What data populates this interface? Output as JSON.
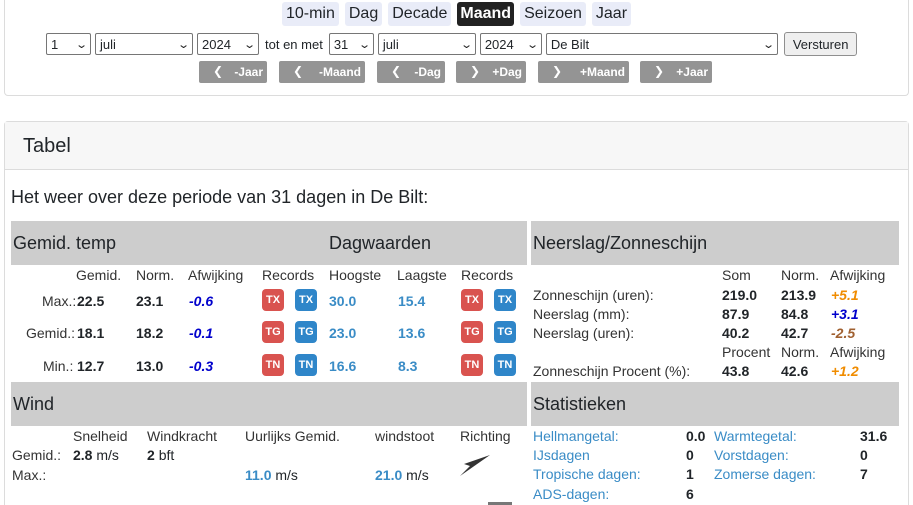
{
  "periods": [
    "10-min",
    "Dag",
    "Decade",
    "Maand",
    "Seizoen",
    "Jaar"
  ],
  "active_period": "Maand",
  "form": {
    "from_day": "1",
    "from_month": "juli",
    "from_year": "2024",
    "separator": "tot en met",
    "to_day": "31",
    "to_month": "juli",
    "to_year": "2024",
    "station": "De Bilt",
    "submit": "Versturen"
  },
  "nav": [
    "-Jaar",
    "-Maand",
    "-Dag",
    "+Dag",
    "+Maand",
    "+Jaar"
  ],
  "card_title": "Tabel",
  "intro": "Het weer over deze periode van 31 dagen in De Bilt:",
  "temp": {
    "title": "Gemid. temp",
    "daily_title": "Dagwaarden",
    "headers": {
      "gemid": "Gemid.",
      "norm": "Norm.",
      "afw": "Afwijking",
      "records": "Records",
      "hoogste": "Hoogste",
      "laagste": "Laagste",
      "records2": "Records"
    },
    "rows": [
      {
        "label": "Max.:",
        "value": "22.5",
        "norm": "23.1",
        "afw": "-0.6",
        "b1": "TX",
        "b2": "TX",
        "hoogste": "30.0",
        "laagste": "15.4",
        "b3": "TX",
        "b4": "TX"
      },
      {
        "label": "Gemid.:",
        "value": "18.1",
        "norm": "18.2",
        "afw": "-0.1",
        "b1": "TG",
        "b2": "TG",
        "hoogste": "23.0",
        "laagste": "13.6",
        "b3": "TG",
        "b4": "TG"
      },
      {
        "label": "Min.:",
        "value": "12.7",
        "norm": "13.0",
        "afw": "-0.3",
        "b1": "TN",
        "b2": "TN",
        "hoogste": "16.6",
        "laagste": "8.3",
        "b3": "TN",
        "b4": "TN"
      }
    ]
  },
  "neerslag": {
    "title": "Neerslag/Zonneschijn",
    "headers": {
      "som": "Som",
      "norm": "Norm.",
      "afw": "Afwijking",
      "procent": "Procent"
    },
    "rows": [
      {
        "label": "Zonneschijn (uren):",
        "value": "219.0",
        "norm": "213.9",
        "afw": "+5.1"
      },
      {
        "label": "Neerslag (mm):",
        "value": "87.9",
        "norm": "84.8",
        "afw": "+3.1"
      },
      {
        "label": "Neerslag (uren):",
        "value": "40.2",
        "norm": "42.7",
        "afw": "-2.5"
      },
      {
        "label": "Zonneschijn Procent (%):",
        "value": "43.8",
        "norm": "42.6",
        "afw": "+1.2"
      }
    ]
  },
  "wind": {
    "title": "Wind",
    "headers": {
      "snelheid": "Snelheid",
      "kracht": "Windkracht",
      "uurlijks": "Uurlijks Gemid.",
      "stoot": "windstoot",
      "richting": "Richting"
    },
    "gemid_label": "Gemid.:",
    "max_label": "Max.:",
    "gemid_speed": "2.8",
    "unit": "m/s",
    "gemid_bft": "2",
    "bft_unit": "bft",
    "max_uurlijks": "11.0",
    "max_stoot": "21.0"
  },
  "stats": {
    "title": "Statistieken",
    "left": [
      {
        "label": "Hellmangetal:",
        "value": "0.0"
      },
      {
        "label": "IJsdagen",
        "value": "0"
      },
      {
        "label": "Tropische dagen:",
        "value": "1"
      },
      {
        "label": "ADS-dagen:",
        "value": "6"
      }
    ],
    "right": [
      {
        "label": "Warmtegetal:",
        "value": "31.6"
      },
      {
        "label": "Vorstdagen:",
        "value": "0"
      },
      {
        "label": "Zomerse dagen:",
        "value": "7"
      }
    ]
  }
}
